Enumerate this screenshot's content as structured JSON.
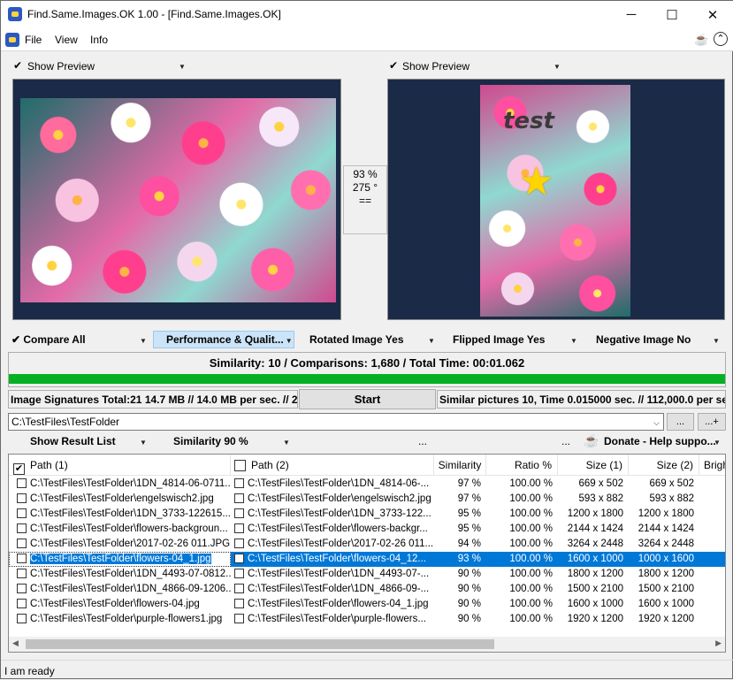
{
  "window": {
    "title": "Find.Same.Images.OK 1.00 - [Find.Same.Images.OK]",
    "minimize": "─",
    "maximize": "☐",
    "close": "✕"
  },
  "menu": {
    "file": "File",
    "view": "View",
    "info": "Info"
  },
  "preview": {
    "left_label": "Show Preview",
    "right_label": "Show Preview",
    "similarity_pct": "93 %",
    "rotation": "275 °",
    "equal": "==",
    "test_text": "test"
  },
  "options": {
    "compare_all": "Compare All",
    "performance": "Performance & Qualit...",
    "rotated": "Rotated Image Yes",
    "flipped": "Flipped Image Yes",
    "negative": "Negative Image No"
  },
  "summary": {
    "text": "Similarity: 10 / Comparisons: 1,680 / Total Time: 00:01.062",
    "progress": 1.0
  },
  "status_row": {
    "signatures": "Image Signatures Total:21  14.7 MB // 14.0 MB per sec. // 2",
    "start": "Start",
    "similar": "Similar pictures 10, Time 0.015000 sec. // 112,000.0 per sec."
  },
  "folder": {
    "path": "C:\\TestFiles\\TestFolder",
    "browse": "...",
    "add": "...+"
  },
  "result_options": {
    "show_list": "Show Result List",
    "similarity": "Similarity 90 %",
    "dots": "...",
    "dots2": "...",
    "donate": "Donate - Help suppo..."
  },
  "table": {
    "headers": [
      "Path (1)",
      "Path (2)",
      "Similarity",
      "Ratio %",
      "Size (1)",
      "Size (2)",
      "Brigh"
    ],
    "rows": [
      {
        "p1": "C:\\TestFiles\\TestFolder\\1DN_4814-06-0711...",
        "p2": "C:\\TestFiles\\TestFolder\\1DN_4814-06-...",
        "sim": "97 %",
        "ratio": "100.00 %",
        "s1": "669 x 502",
        "s2": "669 x 502"
      },
      {
        "p1": "C:\\TestFiles\\TestFolder\\engelswisch2.jpg",
        "p2": "C:\\TestFiles\\TestFolder\\engelswisch2.jpg",
        "sim": "97 %",
        "ratio": "100.00 %",
        "s1": "593 x 882",
        "s2": "593 x 882"
      },
      {
        "p1": "C:\\TestFiles\\TestFolder\\1DN_3733-122615...",
        "p2": "C:\\TestFiles\\TestFolder\\1DN_3733-122...",
        "sim": "95 %",
        "ratio": "100.00 %",
        "s1": "1200 x 1800",
        "s2": "1200 x 1800"
      },
      {
        "p1": "C:\\TestFiles\\TestFolder\\flowers-backgroun...",
        "p2": "C:\\TestFiles\\TestFolder\\flowers-backgr...",
        "sim": "95 %",
        "ratio": "100.00 %",
        "s1": "2144 x 1424",
        "s2": "2144 x 1424"
      },
      {
        "p1": "C:\\TestFiles\\TestFolder\\2017-02-26 011.JPG",
        "p2": "C:\\TestFiles\\TestFolder\\2017-02-26 011...",
        "sim": "94 %",
        "ratio": "100.00 %",
        "s1": "3264 x 2448",
        "s2": "3264 x 2448"
      },
      {
        "p1": "C:\\TestFiles\\TestFolder\\flowers-04_1.jpg",
        "p2": "C:\\TestFiles\\TestFolder\\flowers-04_12...",
        "sim": "93 %",
        "ratio": "100.00 %",
        "s1": "1600 x 1000",
        "s2": "1000 x 1600"
      },
      {
        "p1": "C:\\TestFiles\\TestFolder\\1DN_4493-07-0812...",
        "p2": "C:\\TestFiles\\TestFolder\\1DN_4493-07-...",
        "sim": "90 %",
        "ratio": "100.00 %",
        "s1": "1800 x 1200",
        "s2": "1800 x 1200"
      },
      {
        "p1": "C:\\TestFiles\\TestFolder\\1DN_4866-09-1206...",
        "p2": "C:\\TestFiles\\TestFolder\\1DN_4866-09-...",
        "sim": "90 %",
        "ratio": "100.00 %",
        "s1": "1500 x 2100",
        "s2": "1500 x 2100"
      },
      {
        "p1": "C:\\TestFiles\\TestFolder\\flowers-04.jpg",
        "p2": "C:\\TestFiles\\TestFolder\\flowers-04_1.jpg",
        "sim": "90 %",
        "ratio": "100.00 %",
        "s1": "1600 x 1000",
        "s2": "1600 x 1000"
      },
      {
        "p1": "C:\\TestFiles\\TestFolder\\purple-flowers1.jpg",
        "p2": "C:\\TestFiles\\TestFolder\\purple-flowers...",
        "sim": "90 %",
        "ratio": "100.00 %",
        "s1": "1920 x 1200",
        "s2": "1920 x 1200"
      }
    ],
    "selected_row": 5
  },
  "status": "I am ready",
  "colors": {
    "progress": "#06b025",
    "selection": "#0078d7",
    "preview_bg": "#1b2a47"
  }
}
